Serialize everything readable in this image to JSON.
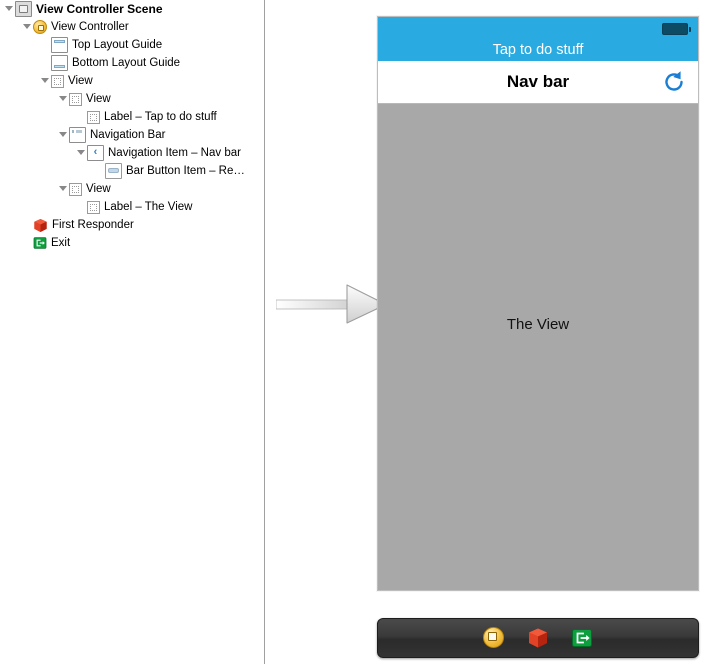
{
  "outline": {
    "title": "View Controller Scene",
    "items": [
      {
        "label": "View Controller Scene",
        "depth": 0,
        "twisty": "open",
        "icon": "scene-icon",
        "bold": true
      },
      {
        "label": "View Controller",
        "depth": 1,
        "twisty": "open",
        "icon": "view-controller-icon",
        "bold": false
      },
      {
        "label": "Top Layout Guide",
        "depth": 2,
        "twisty": "none",
        "icon": "top-layout-guide-icon",
        "bold": false
      },
      {
        "label": "Bottom Layout Guide",
        "depth": 2,
        "twisty": "none",
        "icon": "bottom-layout-guide-icon",
        "bold": false
      },
      {
        "label": "View",
        "depth": 2,
        "twisty": "open",
        "icon": "view-icon",
        "bold": false
      },
      {
        "label": "View",
        "depth": 3,
        "twisty": "open",
        "icon": "view-icon",
        "bold": false
      },
      {
        "label": "Label – Tap to do stuff",
        "depth": 4,
        "twisty": "none",
        "icon": "label-icon",
        "bold": false
      },
      {
        "label": "Navigation Bar",
        "depth": 3,
        "twisty": "open",
        "icon": "navigation-bar-icon",
        "bold": false
      },
      {
        "label": "Navigation Item – Nav bar",
        "depth": 4,
        "twisty": "open",
        "icon": "navigation-item-icon",
        "bold": false
      },
      {
        "label": "Bar Button Item – Re…",
        "depth": 5,
        "twisty": "none",
        "icon": "bar-button-item-icon",
        "bold": false
      },
      {
        "label": "View",
        "depth": 3,
        "twisty": "open",
        "icon": "view-icon",
        "bold": false
      },
      {
        "label": "Label – The View",
        "depth": 4,
        "twisty": "none",
        "icon": "label-icon",
        "bold": false
      },
      {
        "label": "First Responder",
        "depth": 1,
        "twisty": "none",
        "icon": "first-responder-icon",
        "bold": false
      },
      {
        "label": "Exit",
        "depth": 1,
        "twisty": "none",
        "icon": "exit-icon",
        "bold": false
      }
    ]
  },
  "canvas": {
    "entry_arrow": "entry-point-arrow",
    "scene": {
      "status_bar": {
        "label": "Tap to do stuff",
        "battery": "battery-icon",
        "background_color": "#29ABE2",
        "text_color": "#FFFFFF"
      },
      "nav_bar": {
        "title": "Nav bar",
        "right_button": "refresh-icon",
        "right_button_color": "#1a7fd4",
        "background_color": "#FFFFFF"
      },
      "content": {
        "label": "The View",
        "background_color": "#A8A8A8"
      }
    },
    "dock": {
      "items": [
        {
          "icon": "view-controller-icon",
          "name": "dock-view-controller"
        },
        {
          "icon": "first-responder-icon",
          "name": "dock-first-responder"
        },
        {
          "icon": "exit-icon",
          "name": "dock-exit"
        }
      ],
      "background_color": "#333333"
    }
  }
}
